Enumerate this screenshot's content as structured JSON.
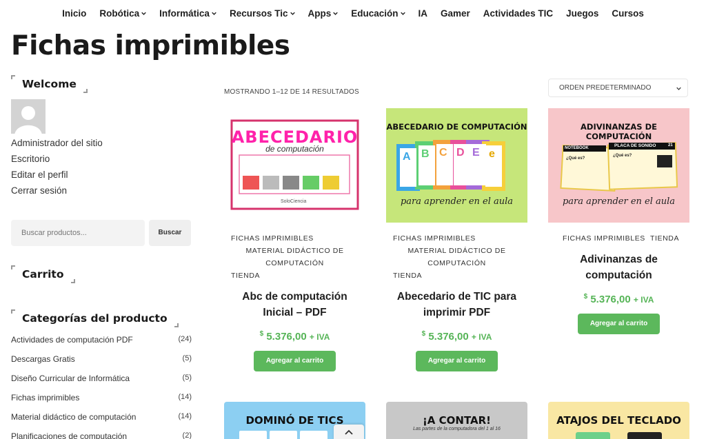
{
  "nav": [
    {
      "label": "Inicio",
      "dropdown": false
    },
    {
      "label": "Robótica",
      "dropdown": true
    },
    {
      "label": "Informática",
      "dropdown": true
    },
    {
      "label": "Recursos Tic",
      "dropdown": true
    },
    {
      "label": "Apps",
      "dropdown": true
    },
    {
      "label": "Educación",
      "dropdown": true
    },
    {
      "label": "IA",
      "dropdown": false
    },
    {
      "label": "Gamer",
      "dropdown": false
    },
    {
      "label": "Actividades TIC",
      "dropdown": false
    },
    {
      "label": "Juegos",
      "dropdown": false
    },
    {
      "label": "Cursos",
      "dropdown": false
    }
  ],
  "page_title": "Fichas imprimibles",
  "sidebar": {
    "welcome_title": "Welcome",
    "user_links": [
      "Administrador del sitio",
      "Escritorio",
      "Editar el perfil",
      "Cerrar sesión"
    ],
    "search_placeholder": "Buscar productos...",
    "search_button": "Buscar",
    "cart_title": "Carrito",
    "categories_title": "Categorías del producto",
    "categories": [
      {
        "name": "Actividades de computación PDF",
        "count": "(24)"
      },
      {
        "name": "Descargas Gratis",
        "count": "(5)"
      },
      {
        "name": "Diseño Curricular de Informática",
        "count": "(5)"
      },
      {
        "name": "Fichas imprimibles",
        "count": "(14)"
      },
      {
        "name": "Material didáctico de computación",
        "count": "(14)"
      },
      {
        "name": "Planificaciones de computación",
        "count": "(2)"
      }
    ]
  },
  "shop": {
    "result_count": "MOSTRANDO 1–12 DE 14 RESULTADOS",
    "order_label": "ORDEN PREDETERMINADO"
  },
  "products": [
    {
      "img": {
        "title": "ABECEDARIO",
        "subtitle": "de computación",
        "brand": "SoloCiencia"
      },
      "cats": [
        "FICHAS IMPRIMIBLES",
        "MATERIAL DIDÁCTICO DE",
        "COMPUTACIÓN",
        "TIENDA"
      ],
      "title_1": "Abc de computación",
      "title_2": "Inicial – PDF",
      "currency": "$",
      "price": "5.376,00",
      "tax": "+ IVA",
      "button": "Agregar al carrito"
    },
    {
      "img": {
        "title": "ABECEDARIO DE COMPUTACIÓN",
        "subtitle": "para aprender en el aula",
        "letters": [
          "A",
          "B",
          "C",
          "D",
          "E",
          "e"
        ]
      },
      "cats": [
        "FICHAS IMPRIMIBLES",
        "MATERIAL DIDÁCTICO DE",
        "COMPUTACIÓN",
        "TIENDA"
      ],
      "title_1": "Abecedario de TIC para",
      "title_2": "imprimir PDF",
      "currency": "$",
      "price": "5.376,00",
      "tax": "+ IVA",
      "button": "Agregar al carrito"
    },
    {
      "img": {
        "title": "ADIVINANZAS DE COMPUTACIÓN",
        "subtitle": "para aprender en el aula",
        "card_1": "NOTEBOOK",
        "card_2": "PLACA DE SONIDO",
        "card_num": "21",
        "question": "¿Qué es?"
      },
      "cats": [
        "FICHAS IMPRIMIBLES",
        "TIENDA"
      ],
      "title_1": "Adivinanzas de",
      "title_2": "computación",
      "currency": "$",
      "price": "5.376,00",
      "tax": "+ IVA",
      "button": "Agregar al carrito"
    }
  ],
  "bottom_cards": [
    {
      "title": "DOMINÓ DE TICS",
      "subtitle": ""
    },
    {
      "title": "¡A CONTAR!",
      "subtitle": "Las partes de la computadora del 1 al 16"
    },
    {
      "title": "ATAJOS DEL TECLADO",
      "subtitle": ""
    }
  ]
}
